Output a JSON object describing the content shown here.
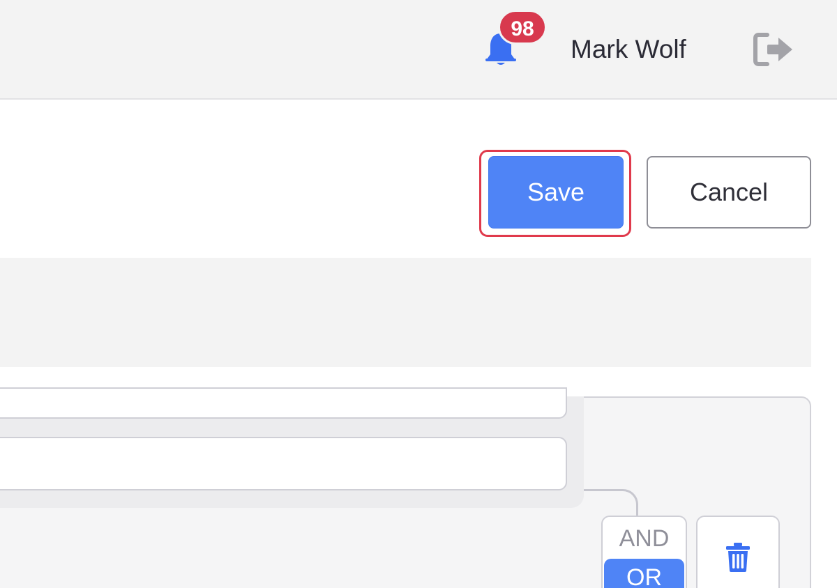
{
  "header": {
    "notification_count": "98",
    "user_name": "Mark Wolf",
    "icons": [
      "bell-icon",
      "logout-icon"
    ]
  },
  "actions": {
    "save_label": "Save",
    "cancel_label": "Cancel"
  },
  "query_builder": {
    "logic_options": [
      "AND",
      "OR"
    ],
    "selected_logic": "OR",
    "delete_icon": "trash-icon"
  },
  "colors": {
    "accent": "#4f84f6",
    "badge": "#d8394e",
    "highlight_outline": "#e03a4c"
  }
}
